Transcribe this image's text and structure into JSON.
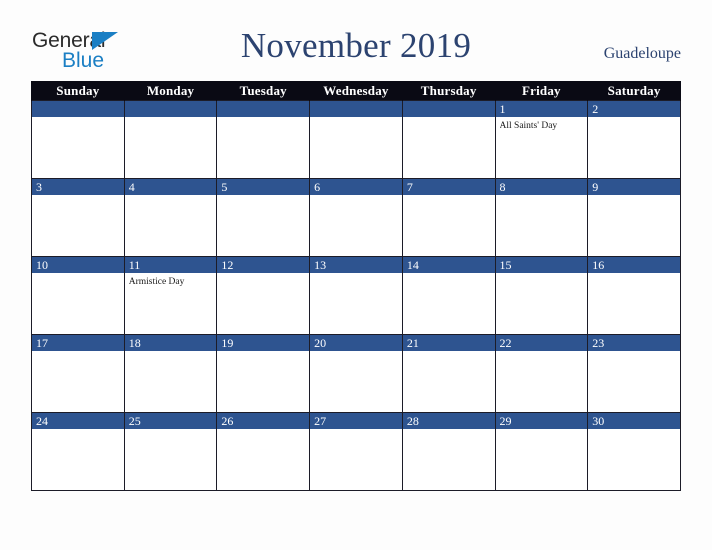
{
  "header": {
    "logo": {
      "line1": "General",
      "line2": "Blue",
      "triangle_icon": "triangle-icon",
      "color_primary": "#1b7fc4",
      "color_text": "#2b2b2b"
    },
    "month_title": "November 2019",
    "location": "Guadeloupe",
    "title_color": "#2c4370"
  },
  "calendar": {
    "weekdays": [
      "Sunday",
      "Monday",
      "Tuesday",
      "Wednesday",
      "Thursday",
      "Friday",
      "Saturday"
    ],
    "header_bg": "#0a0a14",
    "day_bar_bg": "#2e5490",
    "weeks": [
      [
        {
          "day": "",
          "events": []
        },
        {
          "day": "",
          "events": []
        },
        {
          "day": "",
          "events": []
        },
        {
          "day": "",
          "events": []
        },
        {
          "day": "",
          "events": []
        },
        {
          "day": "1",
          "events": [
            "All Saints' Day"
          ]
        },
        {
          "day": "2",
          "events": []
        }
      ],
      [
        {
          "day": "3",
          "events": []
        },
        {
          "day": "4",
          "events": []
        },
        {
          "day": "5",
          "events": []
        },
        {
          "day": "6",
          "events": []
        },
        {
          "day": "7",
          "events": []
        },
        {
          "day": "8",
          "events": []
        },
        {
          "day": "9",
          "events": []
        }
      ],
      [
        {
          "day": "10",
          "events": []
        },
        {
          "day": "11",
          "events": [
            "Armistice Day"
          ]
        },
        {
          "day": "12",
          "events": []
        },
        {
          "day": "13",
          "events": []
        },
        {
          "day": "14",
          "events": []
        },
        {
          "day": "15",
          "events": []
        },
        {
          "day": "16",
          "events": []
        }
      ],
      [
        {
          "day": "17",
          "events": []
        },
        {
          "day": "18",
          "events": []
        },
        {
          "day": "19",
          "events": []
        },
        {
          "day": "20",
          "events": []
        },
        {
          "day": "21",
          "events": []
        },
        {
          "day": "22",
          "events": []
        },
        {
          "day": "23",
          "events": []
        }
      ],
      [
        {
          "day": "24",
          "events": []
        },
        {
          "day": "25",
          "events": []
        },
        {
          "day": "26",
          "events": []
        },
        {
          "day": "27",
          "events": []
        },
        {
          "day": "28",
          "events": []
        },
        {
          "day": "29",
          "events": []
        },
        {
          "day": "30",
          "events": []
        }
      ]
    ]
  }
}
